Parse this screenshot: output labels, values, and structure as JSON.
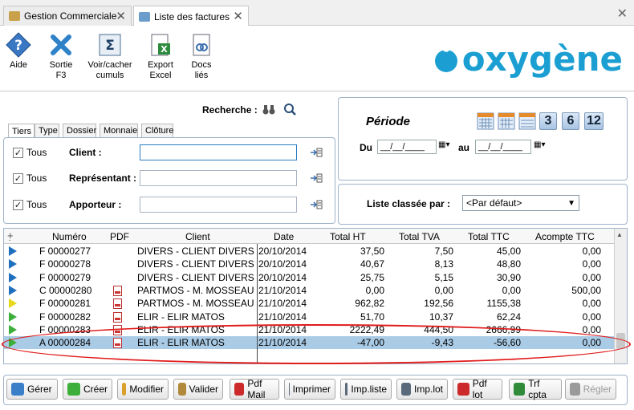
{
  "tabs": [
    {
      "label": "Gestion Commerciale",
      "active": false
    },
    {
      "label": "Liste des factures",
      "active": true
    }
  ],
  "toolbar": {
    "aide": "Aide",
    "sortie_1": "Sortie",
    "sortie_2": "F3",
    "voir_1": "Voir/cacher",
    "voir_2": "cumuls",
    "export_1": "Export",
    "export_2": "Excel",
    "docs_1": "Docs",
    "docs_2": "liés"
  },
  "logo": "oxygène",
  "search": {
    "label": "Recherche :"
  },
  "subtabs": [
    "Tiers",
    "Type",
    "Dossier",
    "Monnaie",
    "Clôture"
  ],
  "filters": [
    {
      "check": "Tous",
      "label": "Client :"
    },
    {
      "check": "Tous",
      "label": "Représentant :"
    },
    {
      "check": "Tous",
      "label": "Apporteur :"
    }
  ],
  "periode": {
    "title": "Période",
    "du": "Du",
    "au": "au",
    "du_value": "__/__/____",
    "au_value": "__/__/____",
    "quick": [
      "3",
      "6",
      "12"
    ]
  },
  "sort": {
    "label": "Liste classée par :",
    "value": "<Par défaut>"
  },
  "grid": {
    "headers": [
      "Numéro",
      "PDF",
      "Client",
      "Date",
      "Total HT",
      "Total TVA",
      "Total TTC",
      "Acompte TTC"
    ],
    "rows": [
      {
        "flag": "#1f6fbf",
        "numero": "F 00000277",
        "pdf": false,
        "client": "DIVERS - CLIENT DIVERS TEST",
        "date": "20/10/2014",
        "ht": "37,50",
        "tva": "7,50",
        "ttc": "45,00",
        "acompte": "0,00"
      },
      {
        "flag": "#1f6fbf",
        "numero": "F 00000278",
        "pdf": false,
        "client": "DIVERS - CLIENT DIVERS TEST",
        "date": "20/10/2014",
        "ht": "40,67",
        "tva": "8,13",
        "ttc": "48,80",
        "acompte": "0,00"
      },
      {
        "flag": "#1f6fbf",
        "numero": "F 00000279",
        "pdf": false,
        "client": "DIVERS - CLIENT DIVERS TEST",
        "date": "20/10/2014",
        "ht": "25,75",
        "tva": "5,15",
        "ttc": "30,90",
        "acompte": "0,00"
      },
      {
        "flag": "#1f6fbf",
        "numero": "C 00000280",
        "pdf": true,
        "client": "PARTMOS - M. MOSSEAU ERIC",
        "date": "21/10/2014",
        "ht": "0,00",
        "tva": "0,00",
        "ttc": "0,00",
        "acompte": "500,00"
      },
      {
        "flag": "#e8d81a",
        "numero": "F 00000281",
        "pdf": true,
        "client": "PARTMOS - M. MOSSEAU ERIC",
        "date": "21/10/2014",
        "ht": "962,82",
        "tva": "192,56",
        "ttc": "1155,38",
        "acompte": "0,00"
      },
      {
        "flag": "#3cae3a",
        "numero": "F 00000282",
        "pdf": true,
        "client": "ELIR - ELIR MATOS",
        "date": "21/10/2014",
        "ht": "51,70",
        "tva": "10,37",
        "ttc": "62,24",
        "acompte": "0,00"
      },
      {
        "flag": "#3cae3a",
        "numero": "F 00000283",
        "pdf": true,
        "client": "ELIR - ELIR MATOS",
        "date": "21/10/2014",
        "ht": "2222,49",
        "tva": "444,50",
        "ttc": "2666,99",
        "acompte": "0,00"
      },
      {
        "flag": "#3cae3a",
        "numero": "A 00000284",
        "pdf": true,
        "client": "ELIR - ELIR MATOS",
        "date": "21/10/2014",
        "ht": "-47,00",
        "tva": "-9,43",
        "ttc": "-56,60",
        "acompte": "0,00",
        "selected": true
      }
    ]
  },
  "buttons": [
    {
      "label": "Gérer",
      "color": "#3a7fc8"
    },
    {
      "label": "Créer",
      "color": "#3cae3a"
    },
    {
      "label": "Modifier",
      "color": "#d9a12a"
    },
    {
      "label": "Valider",
      "color": "#b08a3a"
    },
    {
      "label": "Pdf Mail",
      "color": "#cc2a2a"
    },
    {
      "label": "Imprimer",
      "color": "#5a6a7a"
    },
    {
      "label": "Imp.liste",
      "color": "#5a6a7a"
    },
    {
      "label": "Imp.lot",
      "color": "#5a6a7a"
    },
    {
      "label": "Pdf lot",
      "color": "#cc2a2a"
    },
    {
      "label": "Trf cpta",
      "color": "#2f8a3a"
    },
    {
      "label": "Régler",
      "color": "#9a9a9a",
      "disabled": true
    }
  ]
}
